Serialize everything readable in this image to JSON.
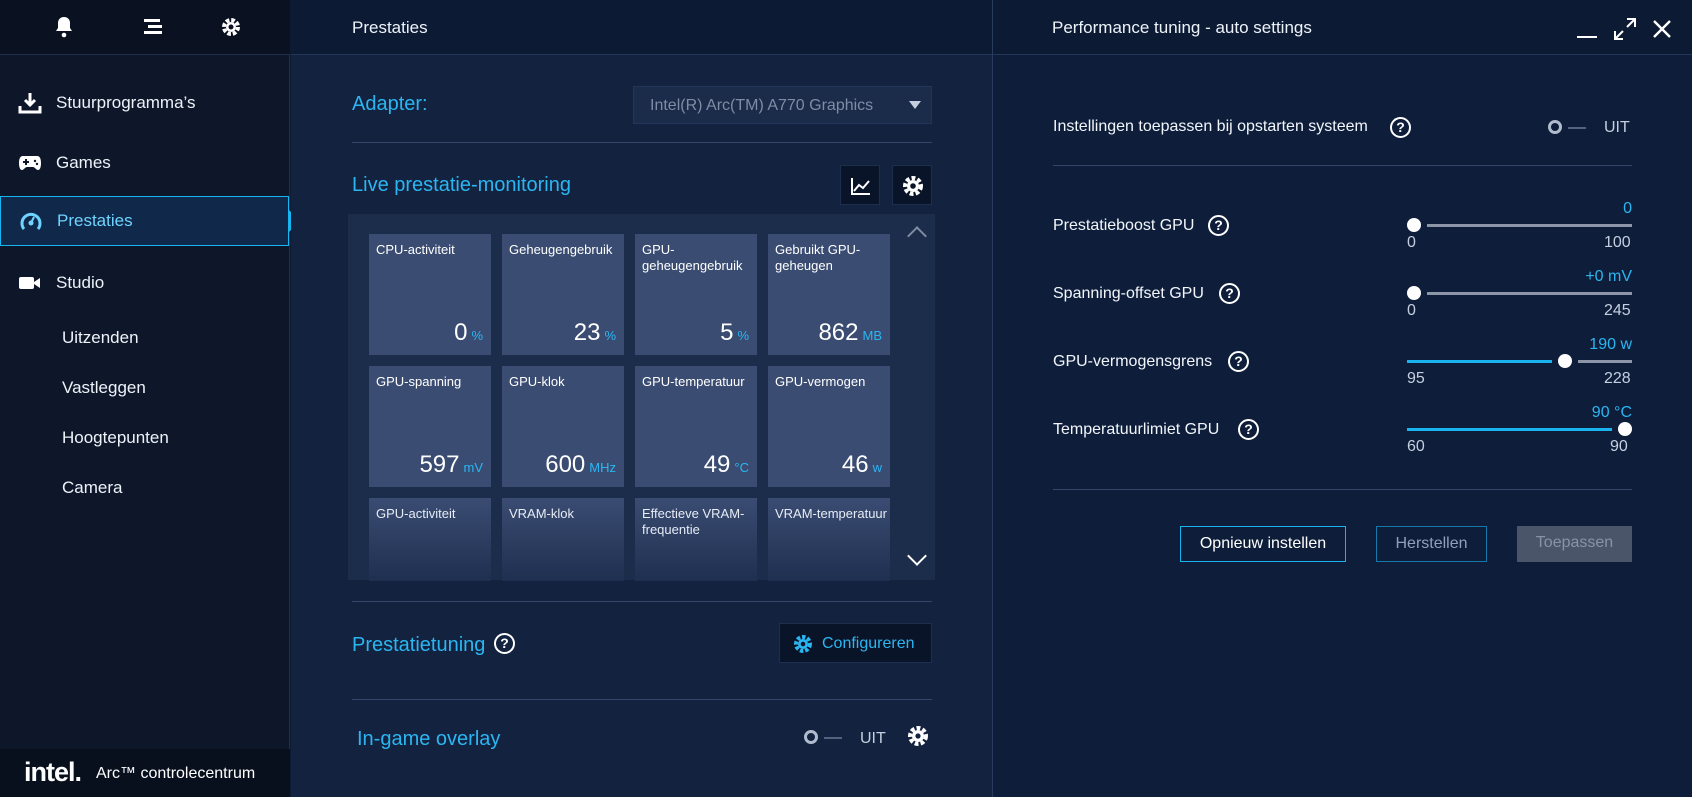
{
  "app": {
    "footer_brand": "intel.",
    "footer_title": "Arc™ controlecentrum"
  },
  "sidebar": {
    "top_icons": [
      "bell-icon",
      "menu-icon",
      "gear-icon"
    ],
    "items": [
      {
        "label": "Stuurprogramma’s",
        "icon": "download-icon"
      },
      {
        "label": "Games",
        "icon": "gamepad-icon"
      },
      {
        "label": "Prestaties",
        "icon": "gauge-icon",
        "active": true
      },
      {
        "label": "Studio",
        "icon": "video-camera-icon"
      }
    ],
    "sub_items": [
      {
        "label": "Uitzenden"
      },
      {
        "label": "Vastleggen"
      },
      {
        "label": "Hoogtepunten"
      },
      {
        "label": "Camera"
      }
    ]
  },
  "middle": {
    "title": "Prestaties",
    "adapter_label": "Adapter:",
    "adapter_value": "Intel(R) Arc(TM) A770 Graphics",
    "monitoring_title": "Live prestatie-monitoring",
    "tiles": [
      {
        "label": "CPU-activiteit",
        "value": "0",
        "unit": "%"
      },
      {
        "label": "Geheugengebruik",
        "value": "23",
        "unit": "%"
      },
      {
        "label": "GPU-geheugengebruik",
        "value": "5",
        "unit": "%"
      },
      {
        "label": "Gebruikt GPU-geheugen",
        "value": "862",
        "unit": "MB"
      },
      {
        "label": "GPU-spanning",
        "value": "597",
        "unit": "mV"
      },
      {
        "label": "GPU-klok",
        "value": "600",
        "unit": "MHz"
      },
      {
        "label": "GPU-temperatuur",
        "value": "49",
        "unit": "°C"
      },
      {
        "label": "GPU-vermogen",
        "value": "46",
        "unit": "w"
      },
      {
        "label": "GPU-activiteit"
      },
      {
        "label": "VRAM-klok"
      },
      {
        "label": "Effectieve VRAM-frequentie"
      },
      {
        "label": "VRAM-temperatuur"
      }
    ],
    "tuning_title": "Prestatietuning",
    "configure_label": "Configureren",
    "overlay_title": "In-game overlay",
    "overlay_state": "UIT"
  },
  "right": {
    "title": "Performance tuning - auto settings",
    "startup_label": "Instellingen toepassen bij opstarten systeem",
    "startup_state": "UIT",
    "sliders": [
      {
        "label": "Prestatieboost GPU",
        "value": "0",
        "min": "0",
        "max": "100",
        "level": 0.0
      },
      {
        "label": "Spanning-offset GPU",
        "value": "+0 mV",
        "min": "0",
        "max": "245",
        "level": 0.0
      },
      {
        "label": "GPU-vermogensgrens",
        "value": "190 w",
        "min": "95",
        "max": "228",
        "level": 0.714
      },
      {
        "label": "Temperatuurlimiet GPU",
        "value": "90 °C",
        "min": "60",
        "max": "90",
        "level": 1.0
      }
    ],
    "buttons": {
      "reset": "Opnieuw instellen",
      "restore": "Herstellen",
      "apply": "Toepassen"
    }
  },
  "colors": {
    "accent": "#19b3f0",
    "background": "#0c1a33",
    "tile": "#3a4c72"
  }
}
